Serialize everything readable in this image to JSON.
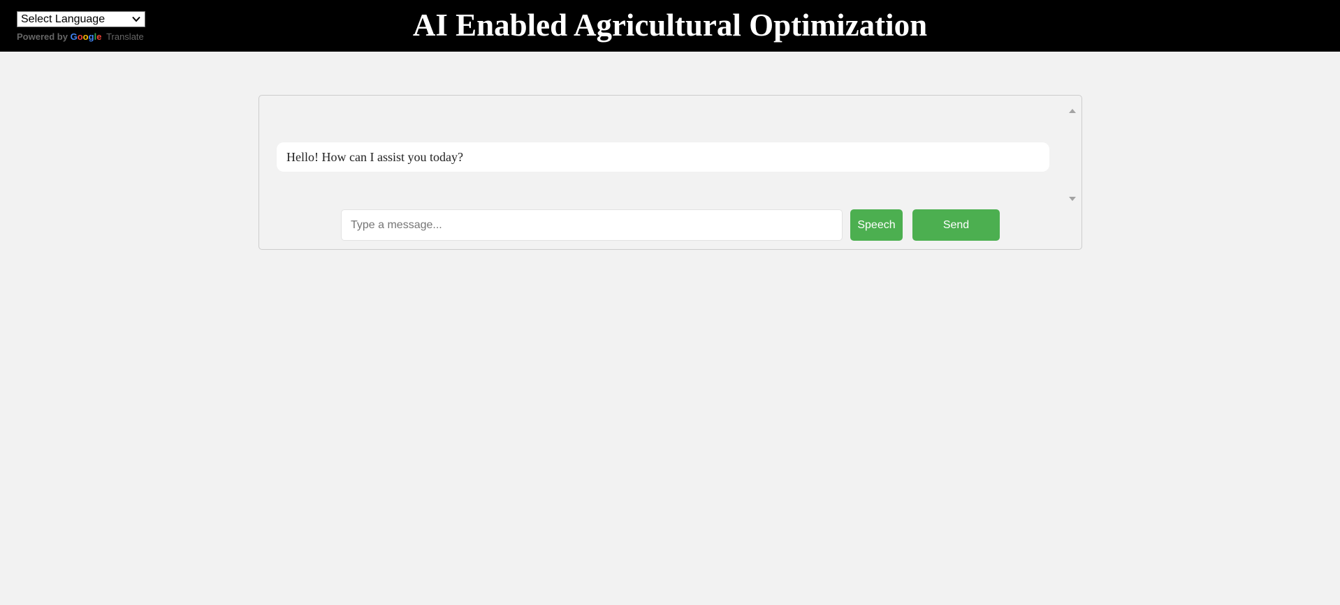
{
  "header": {
    "title": "AI Enabled Agricultural Optimization",
    "background": "#000000"
  },
  "translate": {
    "selected_language": "Select Language",
    "powered_by": "Powered by",
    "google_letters": [
      "G",
      "o",
      "o",
      "g",
      "l",
      "e"
    ],
    "google_colors": [
      "#4285f4",
      "#ea4335",
      "#fbbc05",
      "#4285f4",
      "#34a853",
      "#ea4335"
    ],
    "translate_label": "Translate"
  },
  "chat": {
    "messages": [
      {
        "sender": "bot",
        "text": "Hello! How can I assist you today?"
      }
    ],
    "input_placeholder": "Type a message...",
    "input_value": "",
    "speech_label": "Speech",
    "send_label": "Send",
    "button_color": "#4caf50"
  }
}
